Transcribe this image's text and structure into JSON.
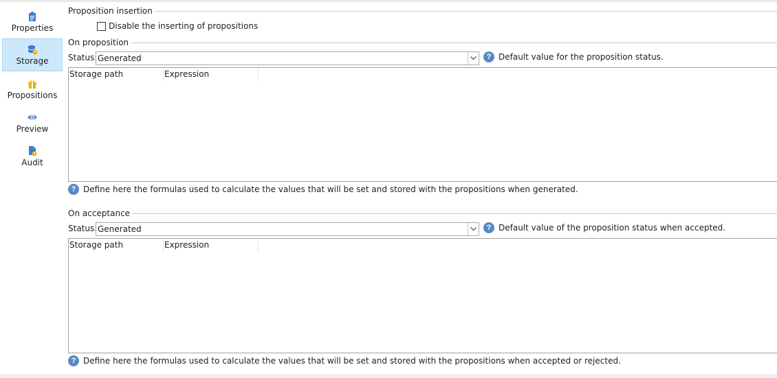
{
  "sidebar": {
    "items": [
      {
        "label": "Properties"
      },
      {
        "label": "Storage",
        "selected": true
      },
      {
        "label": "Propositions"
      },
      {
        "label": "Preview"
      },
      {
        "label": "Audit"
      }
    ]
  },
  "proposition_insertion": {
    "title": "Proposition insertion",
    "checkbox_label": "Disable the inserting of propositions",
    "checkbox_checked": false
  },
  "on_proposition": {
    "title": "On proposition",
    "status_label": "Status:",
    "status_value": "Generated",
    "status_help": "Default value for the proposition status.",
    "columns": [
      "Storage path",
      "Expression"
    ],
    "footer_help": "Define here the formulas used to calculate the values that will be set and stored with the propositions when generated."
  },
  "on_acceptance": {
    "title": "On acceptance",
    "status_label": "Status:",
    "status_value": "Generated",
    "status_help": "Default value of the proposition status when accepted.",
    "columns": [
      "Storage path",
      "Expression"
    ],
    "footer_help": "Define here the formulas used to calculate the values that will be set and stored with the propositions when accepted or rejected."
  },
  "colors": {
    "selected_nav_bg": "#cde8fb",
    "icon_blue": "#3b7bd1",
    "icon_gold": "#e8b200",
    "help_blue": "#5b88c7"
  }
}
